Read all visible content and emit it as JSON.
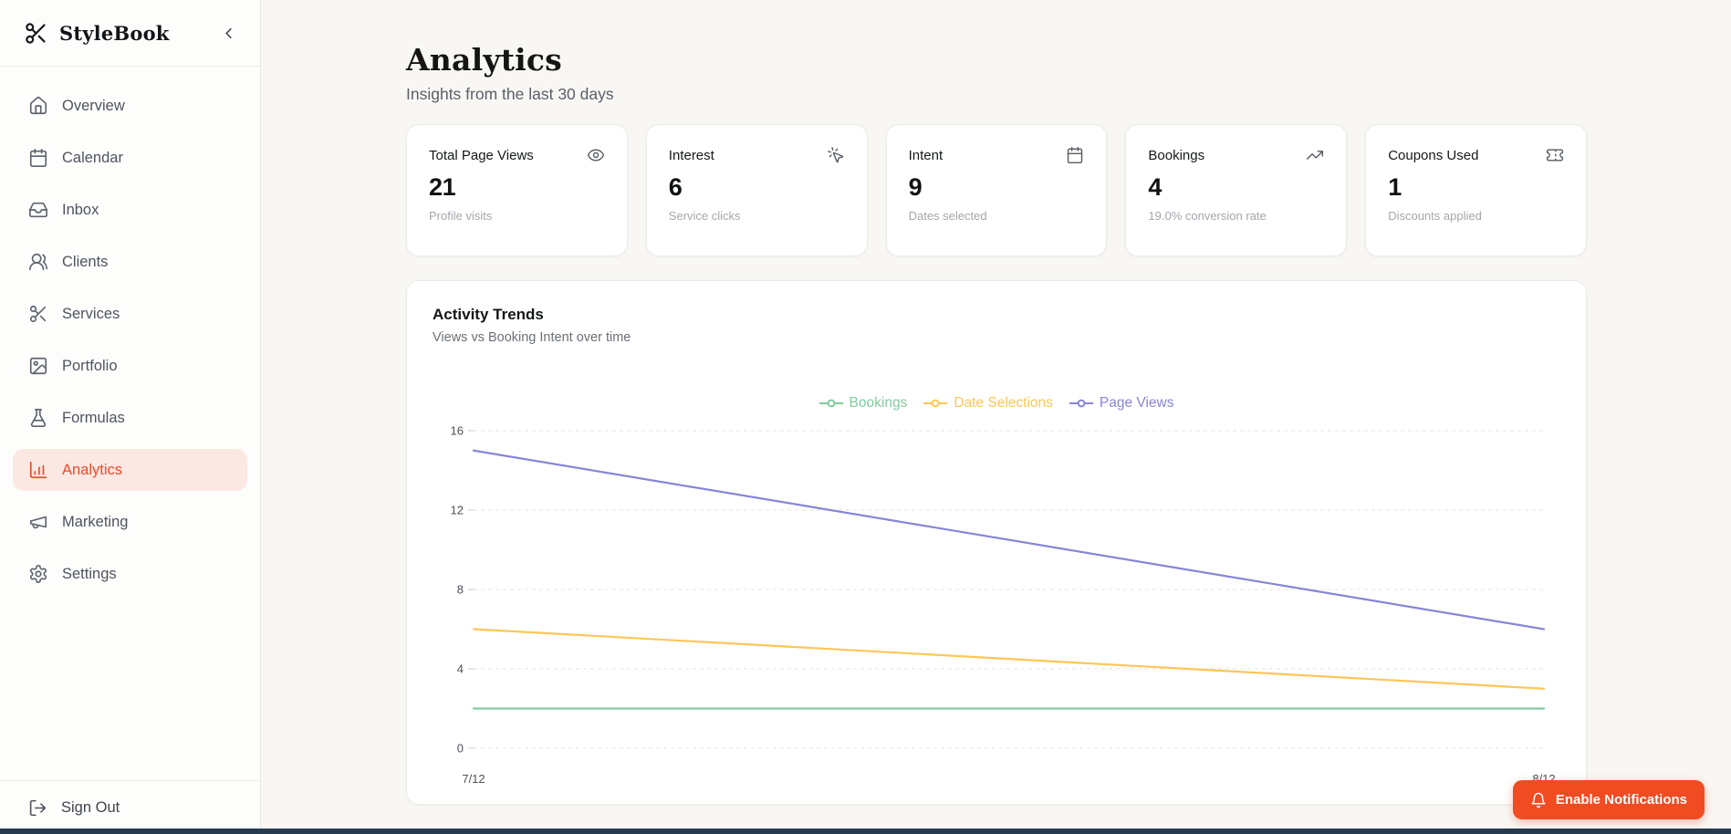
{
  "app": {
    "name": "StyleBook"
  },
  "sidebar": {
    "items": [
      {
        "label": "Overview",
        "icon": "home"
      },
      {
        "label": "Calendar",
        "icon": "calendar"
      },
      {
        "label": "Inbox",
        "icon": "inbox"
      },
      {
        "label": "Clients",
        "icon": "users"
      },
      {
        "label": "Services",
        "icon": "scissors"
      },
      {
        "label": "Portfolio",
        "icon": "image"
      },
      {
        "label": "Formulas",
        "icon": "flask"
      },
      {
        "label": "Analytics",
        "icon": "bar-chart",
        "active": true
      },
      {
        "label": "Marketing",
        "icon": "megaphone"
      },
      {
        "label": "Settings",
        "icon": "gear"
      }
    ],
    "sign_out_label": "Sign Out"
  },
  "header": {
    "title": "Analytics",
    "subtitle": "Insights from the last 30 days"
  },
  "stat_cards": [
    {
      "label": "Total Page Views",
      "value": "21",
      "subtitle": "Profile visits",
      "icon": "eye-icon"
    },
    {
      "label": "Interest",
      "value": "6",
      "subtitle": "Service clicks",
      "icon": "pointer-click-icon"
    },
    {
      "label": "Intent",
      "value": "9",
      "subtitle": "Dates selected",
      "icon": "calendar-icon"
    },
    {
      "label": "Bookings",
      "value": "4",
      "subtitle": "19.0% conversion rate",
      "icon": "trending-up-icon"
    },
    {
      "label": "Coupons Used",
      "value": "1",
      "subtitle": "Discounts applied",
      "icon": "ticket-icon"
    }
  ],
  "chart_card": {
    "title": "Activity Trends",
    "subtitle": "Views vs Booking Intent over time"
  },
  "chart_data": {
    "type": "line",
    "x": [
      "7/12",
      "8/12"
    ],
    "series": [
      {
        "name": "Bookings",
        "color": "#82ca9d",
        "values": [
          2,
          2
        ]
      },
      {
        "name": "Date Selections",
        "color": "#ffc658",
        "values": [
          6,
          3
        ]
      },
      {
        "name": "Page Views",
        "color": "#8884d8",
        "values": [
          15,
          6
        ]
      }
    ],
    "yticks": [
      0,
      4,
      8,
      12,
      16
    ],
    "ylim": [
      0,
      16
    ],
    "grid": "horizontal-dashed",
    "legend_position": "top-center"
  },
  "notification_button": {
    "label": "Enable Notifications",
    "icon": "bell",
    "color": "#f14b22"
  },
  "theme": {
    "active_accent": "#f04a28",
    "active_bg": "#fce8e2",
    "gridline": "#e4e3df"
  }
}
